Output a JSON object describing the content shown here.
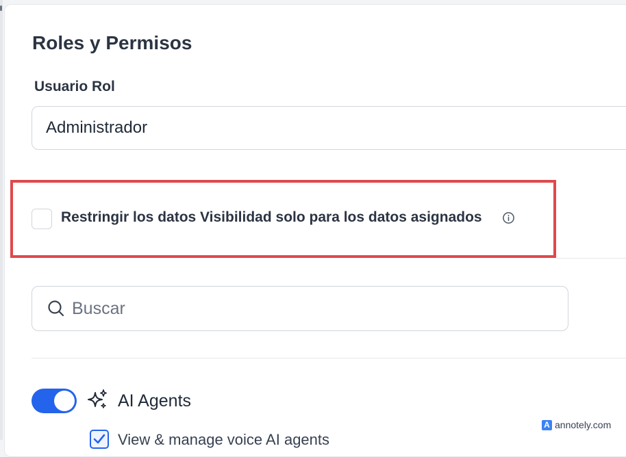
{
  "section": {
    "title": "Roles y Permisos"
  },
  "role_field": {
    "label": "Usuario Rol",
    "value": "Administrador"
  },
  "restrict_option": {
    "label": "Restringir los datos Visibilidad solo para los datos asignados",
    "checked": false,
    "icon": "info-icon"
  },
  "search": {
    "placeholder": "Buscar",
    "icon": "search-icon"
  },
  "permission_group": {
    "label": "AI Agents",
    "enabled": true,
    "icon": "sparkle-icon",
    "items": [
      {
        "label": "View & manage voice AI agents",
        "checked": true
      }
    ]
  },
  "watermark": {
    "text": "annotely.com"
  },
  "colors": {
    "accent": "#2463eb",
    "highlight_border": "#e0484b"
  }
}
